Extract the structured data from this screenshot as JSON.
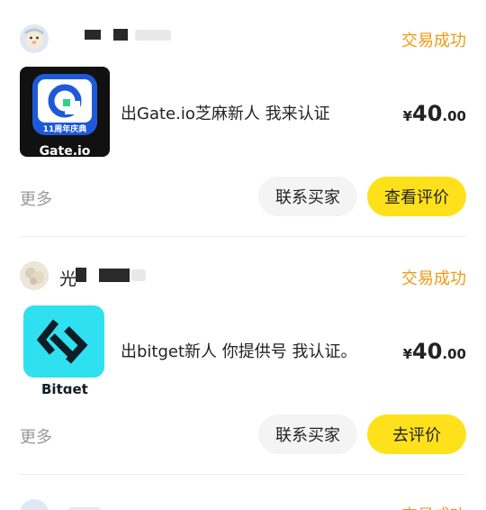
{
  "orders": [
    {
      "status": "交易成功",
      "product_logo_text": "11周年庆典",
      "product_caption": "Gate.io",
      "title": "出Gate.io芝麻新人 我来认证",
      "price": {
        "currency": "¥",
        "integer": "40",
        "decimal": ".00"
      },
      "more_label": "更多",
      "contact_label": "联系买家",
      "action_label": "查看评价"
    },
    {
      "username": "光",
      "status": "交易成功",
      "product_caption": "Bitget",
      "title": "出bitget新人 你提供号 我认证。",
      "price": {
        "currency": "¥",
        "integer": "40",
        "decimal": ".00"
      },
      "more_label": "更多",
      "contact_label": "联系买家",
      "action_label": "去评价"
    },
    {
      "status": "交易成功"
    }
  ],
  "colors": {
    "status": "#f09a12",
    "primary_button": "#ffe11b",
    "secondary_button": "#f4f4f4",
    "muted_text": "#999999"
  },
  "icons": {
    "avatar_1": "cartoon-avatar-icon",
    "avatar_2": "photo-avatar-icon",
    "gate_logo": "gate-io-logo-icon",
    "bitget_logo": "bitget-logo-icon"
  }
}
